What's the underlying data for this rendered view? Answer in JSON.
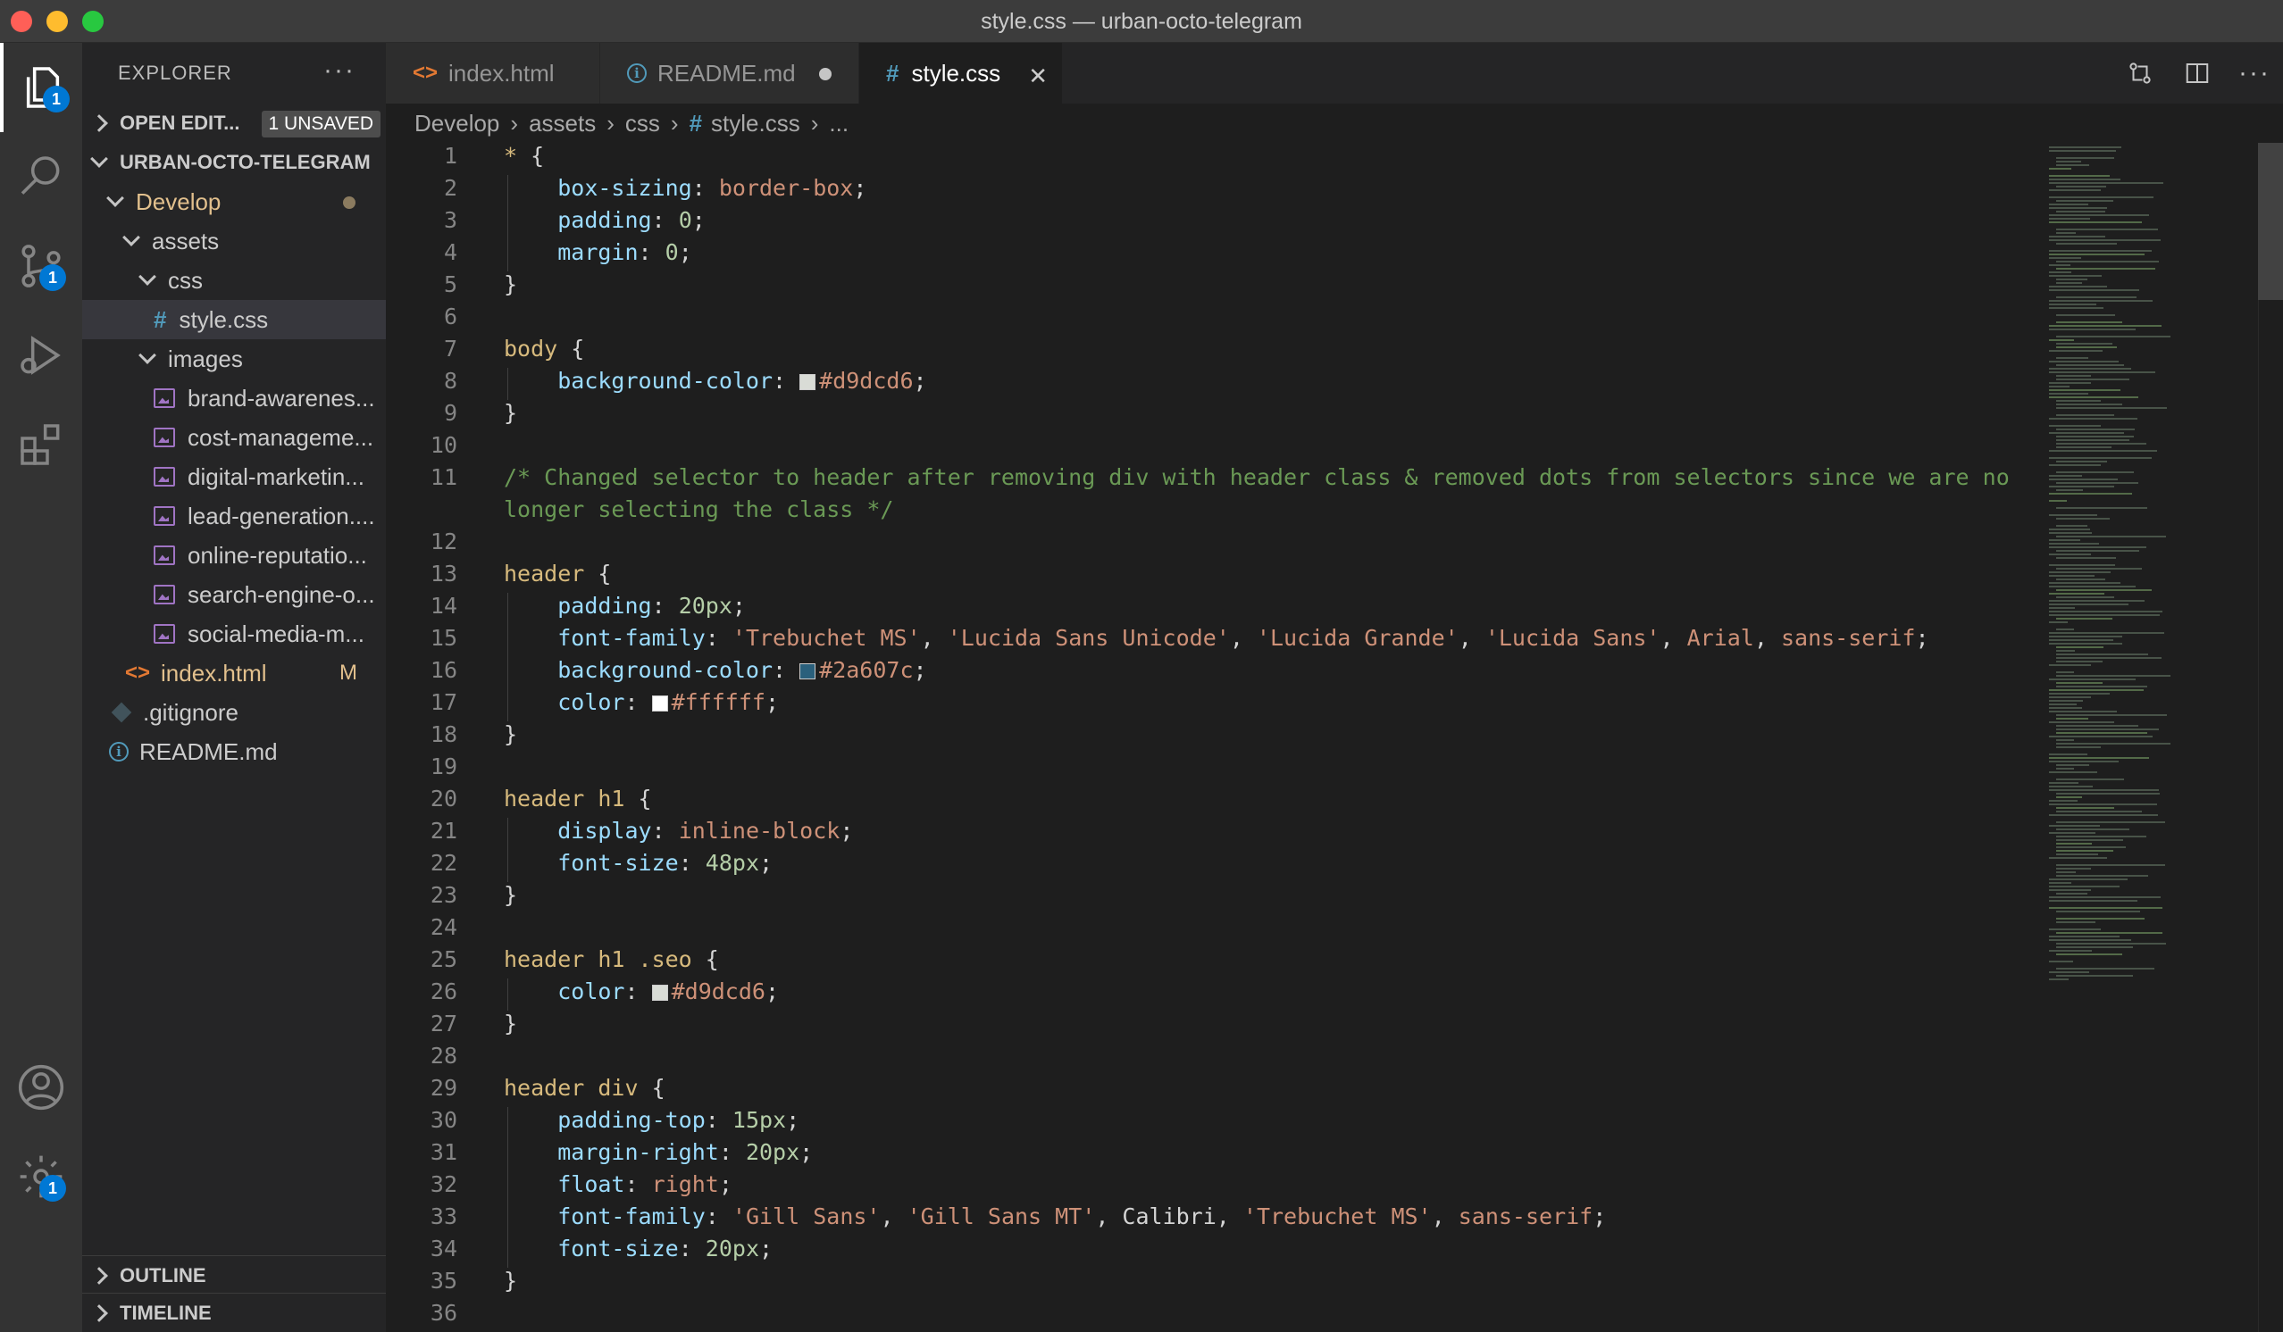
{
  "window": {
    "title": "style.css — urban-octo-telegram"
  },
  "activity_bar": {
    "items": [
      {
        "name": "explorer-icon",
        "badge": "1"
      },
      {
        "name": "search-icon",
        "badge": ""
      },
      {
        "name": "source-control-icon",
        "badge": "1"
      },
      {
        "name": "run-debug-icon",
        "badge": ""
      },
      {
        "name": "extensions-icon",
        "badge": ""
      },
      {
        "name": "accounts-icon",
        "badge": ""
      },
      {
        "name": "manage-gear-icon",
        "badge": "1"
      }
    ]
  },
  "sidebar": {
    "title": "EXPLORER",
    "more": "···",
    "open_editors": {
      "label": "OPEN EDIT...",
      "badge": "1 UNSAVED"
    },
    "workspace": "URBAN-OCTO-TELEGRAM",
    "tree": {
      "develop": "Develop",
      "assets": "assets",
      "css": "css",
      "style_css": "style.css",
      "images": "images",
      "images_files": [
        "brand-awarenes...",
        "cost-manageme...",
        "digital-marketin...",
        "lead-generation....",
        "online-reputatio...",
        "search-engine-o...",
        "social-media-m..."
      ],
      "index_html": "index.html",
      "index_flag": "M",
      "gitignore": ".gitignore",
      "readme": "README.md"
    },
    "outline": "OUTLINE",
    "timeline": "TIMELINE"
  },
  "tabs": [
    {
      "label": "index.html",
      "icon": "html-icon",
      "active": false
    },
    {
      "label": "README.md",
      "icon": "info-icon",
      "active": false,
      "modified": true
    },
    {
      "label": "style.css",
      "icon": "hash-icon",
      "active": true
    }
  ],
  "breadcrumb": [
    "Develop",
    "assets",
    "css",
    "style.css",
    "..."
  ],
  "editor": {
    "line_numbers": [
      "1",
      "2",
      "3",
      "4",
      "5",
      "6",
      "7",
      "8",
      "9",
      "10",
      "11",
      "",
      "12",
      "13",
      "14",
      "15",
      "16",
      "17",
      "18",
      "19",
      "20",
      "21",
      "22",
      "23",
      "24",
      "25",
      "26",
      "27",
      "28",
      "29",
      "30",
      "31",
      "32",
      "33",
      "34",
      "35",
      "36"
    ],
    "colors": {
      "d9dcd6": "#d9dcd6",
      "2a607c": "#2a607c",
      "ffffff": "#ffffff"
    }
  }
}
